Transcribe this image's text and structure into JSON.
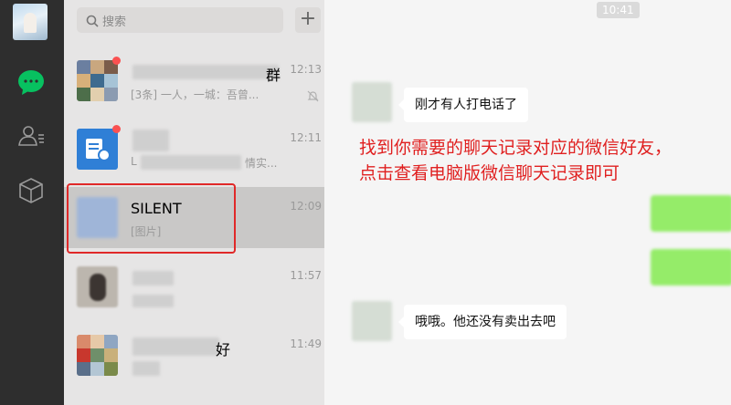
{
  "search": {
    "placeholder": "搜索"
  },
  "chats": [
    {
      "name": "群",
      "preview": "[3条] 一人，一城：吾曾...",
      "time": "12:13",
      "unread": true,
      "muted": true
    },
    {
      "name": "",
      "preview_prefix": "L",
      "preview": "情实...",
      "time": "12:11",
      "unread": true,
      "muted": false
    },
    {
      "name": "SILENT",
      "preview": "[图片]",
      "time": "12:09",
      "unread": false,
      "muted": false,
      "selected": true
    },
    {
      "name": "",
      "preview": "",
      "time": "11:57",
      "unread": false,
      "muted": false
    },
    {
      "name": "好",
      "preview": "",
      "time": "11:49",
      "unread": false,
      "muted": false
    }
  ],
  "conversation": {
    "timestamp": "10:41",
    "messages": [
      {
        "direction": "in",
        "text": "刚才有人打电话了"
      },
      {
        "direction": "out",
        "text": ""
      },
      {
        "direction": "out",
        "text": ""
      },
      {
        "direction": "in",
        "text": "哦哦。他还没有卖出去吧"
      }
    ]
  },
  "annotation": {
    "line1": "找到你需要的聊天记录对应的微信好友，",
    "line2": "点击查看电脑版微信聊天记录即可"
  },
  "colors": {
    "rail": "#2e2e2e",
    "list_bg": "#e6e5e5",
    "selected_row": "#c9c8c7",
    "chat_bg": "#f5f5f5",
    "accent_green": "#07c160",
    "bubble_out": "#95ec69",
    "annotation_red": "#e02020",
    "unread_dot": "#fa5151"
  },
  "icons": {
    "rail": [
      "chat-icon",
      "contacts-icon",
      "favorites-icon"
    ],
    "list": [
      "search-icon",
      "plus-icon",
      "mute-icon"
    ]
  }
}
